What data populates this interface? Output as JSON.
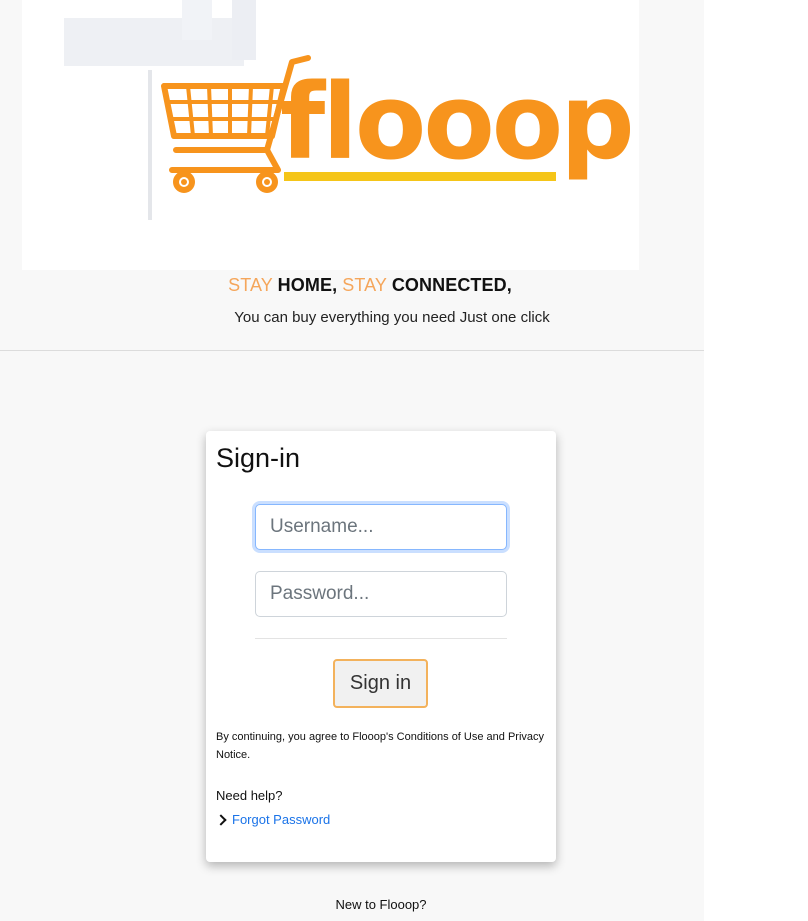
{
  "brand": {
    "logo_text": "flooop",
    "logo_color": "#f7941d",
    "underline_color": "#f5c518"
  },
  "tagline": {
    "stay1": "STAY",
    "home": "HOME,",
    "stay2": "STAY",
    "connected": "CONNECTED,",
    "soft_color": "#f5a65b"
  },
  "subtagline": "You can buy everything you need Just one click",
  "signin": {
    "title": "Sign-in",
    "username_placeholder": "Username...",
    "password_placeholder": "Password...",
    "button_label": "Sign in",
    "legal_text": "By continuing, you agree to Flooop's Conditions of Use and Privacy Notice.",
    "help_heading": "Need help?",
    "forgot_label": "Forgot Password",
    "accent_color": "#f3b25c",
    "link_color": "#1a73e8"
  },
  "footer": {
    "new_to": "New to Flooop?"
  },
  "icons": {
    "cart": "shopping-cart-icon",
    "forgot_chevron": "chevron-right-icon"
  }
}
